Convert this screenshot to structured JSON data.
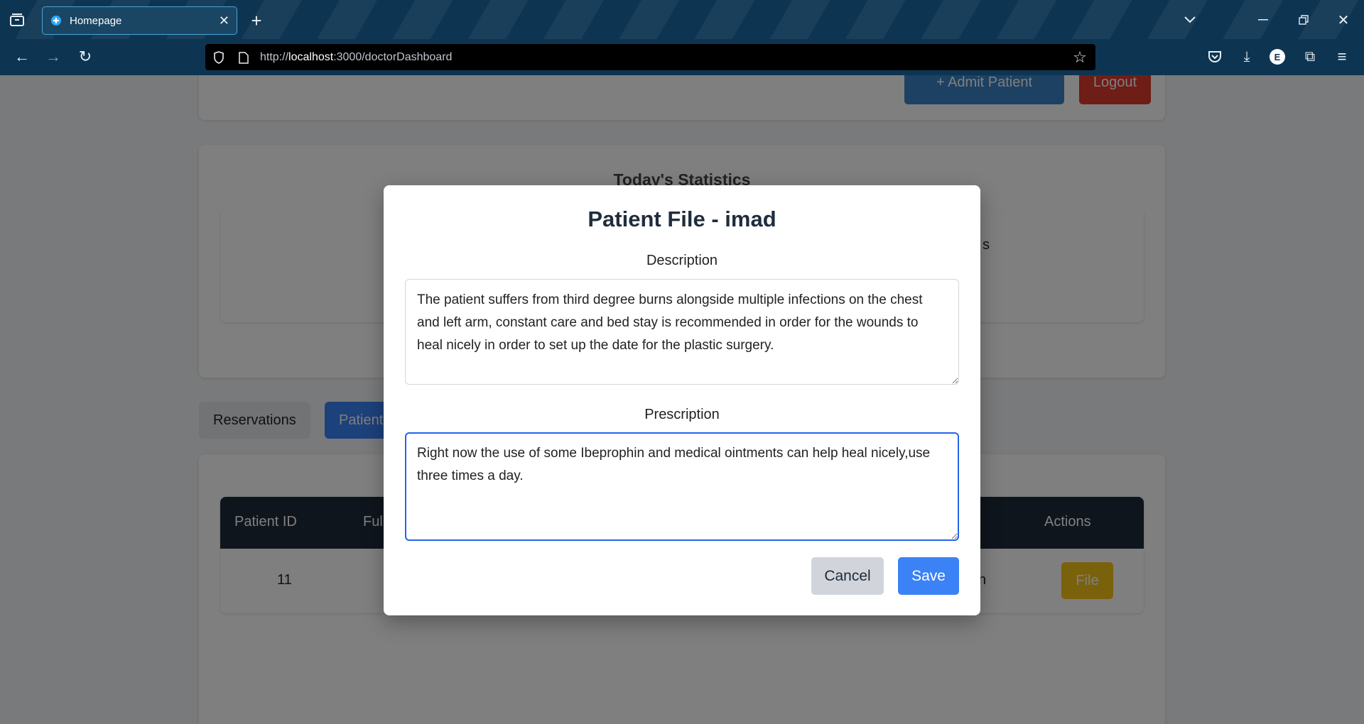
{
  "browser": {
    "tab_title": "Homepage",
    "url_prefix": "http://",
    "url_host": "localhost",
    "url_rest": ":3000/doctorDashboard"
  },
  "header": {
    "admit_label": "+ Admit Patient",
    "logout_label": "Logout"
  },
  "stats": {
    "title": "Today's Statistics",
    "partial_text": "s"
  },
  "tabs": {
    "reservations": "Reservations",
    "patients": "Patients"
  },
  "table": {
    "headers": [
      "Patient ID",
      "Full",
      "Actions"
    ],
    "rows": [
      {
        "id": "11",
        "partial": "n",
        "action": "File"
      }
    ]
  },
  "modal": {
    "title": "Patient File - imad",
    "description_label": "Description",
    "description_value": "The patient suffers from third degree burns alongside multiple infections on the chest and left arm, constant care and bed stay is recommended in order for the wounds to heal nicely in order to set up the date for the plastic surgery.",
    "prescription_label": "Prescription",
    "prescription_value": "Right now the use of some Ibeprophin and medical ointments can help heal nicely,use three times a day.",
    "cancel_label": "Cancel",
    "save_label": "Save"
  },
  "colors": {
    "primary": "#3b82f6",
    "admit": "#3b82c4",
    "logout": "#dc3b2f",
    "file": "#f5c518",
    "header_dark": "#1f2a3a"
  }
}
